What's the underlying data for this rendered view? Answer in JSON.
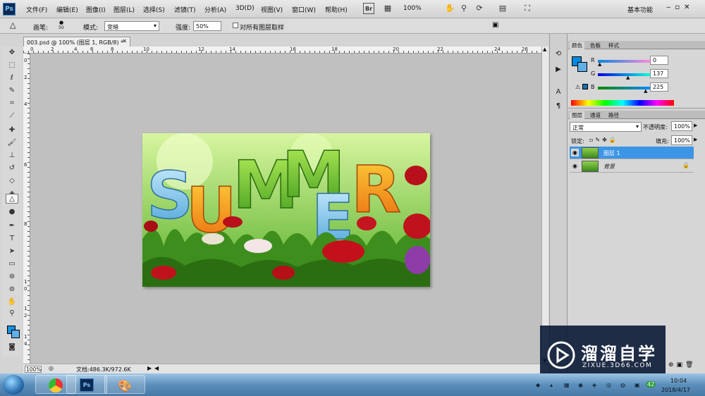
{
  "app": {
    "logo": "Ps"
  },
  "menu": [
    "文件(F)",
    "编辑(E)",
    "图像(I)",
    "图层(L)",
    "选择(S)",
    "滤镜(T)",
    "分析(A)",
    "3D(D)",
    "视图(V)",
    "窗口(W)",
    "帮助(H)"
  ],
  "menubar": {
    "zoom": "100%",
    "workspace": "基本功能",
    "bridge_icon": "Br"
  },
  "options": {
    "brush_label": "画笔:",
    "brush_size": "50",
    "mode_label": "模式:",
    "mode_value": "变暗",
    "strength_label": "强度:",
    "strength_value": "50%",
    "sample_all_label": "对所有图层取样"
  },
  "document": {
    "tab_title": "003.psd @ 100% (图层 1, RGB/8) *",
    "zoom": "100%",
    "doc_info": "文档:486.3K/972.6K",
    "ruler_top": [
      "0",
      "2",
      "4",
      "6",
      "8",
      "10",
      "12",
      "14",
      "16",
      "18",
      "20",
      "22",
      "24",
      "26"
    ],
    "ruler_left": [
      "0",
      "2",
      "4",
      "6",
      "8",
      "1",
      "0",
      "1",
      "2",
      "1",
      "4"
    ]
  },
  "color_panel": {
    "tabs": [
      "颜色",
      "色板",
      "样式"
    ],
    "r_label": "R",
    "g_label": "G",
    "b_label": "B",
    "r": "0",
    "g": "137",
    "b": "225",
    "r_level": 0.0,
    "g_level": 0.54,
    "b_level": 0.88,
    "foreground": "#0089e1"
  },
  "layers_panel": {
    "tabs": [
      "图层",
      "通道",
      "路径"
    ],
    "blend_mode": "正常",
    "opacity_label": "不透明度:",
    "opacity": "100%",
    "lock_label": "锁定:",
    "fill_label": "填充:",
    "fill": "100%",
    "layers": [
      {
        "name": "图层 1",
        "selected": true
      },
      {
        "name": "背景",
        "selected": false,
        "locked": true
      }
    ]
  },
  "artwork": {
    "letters": [
      "S",
      "U",
      "M",
      "M",
      "E",
      "R"
    ]
  },
  "watermark": {
    "title": "溜溜自学",
    "url": "ZIXUE.3D66.COM"
  },
  "taskbar": {
    "time": "10:04",
    "date": "2018/4/17",
    "ps_label": "Ps",
    "tray_badge": "42"
  },
  "colors": {
    "selected_layer": "#3d95e6",
    "accent": "#1a8fe0"
  }
}
